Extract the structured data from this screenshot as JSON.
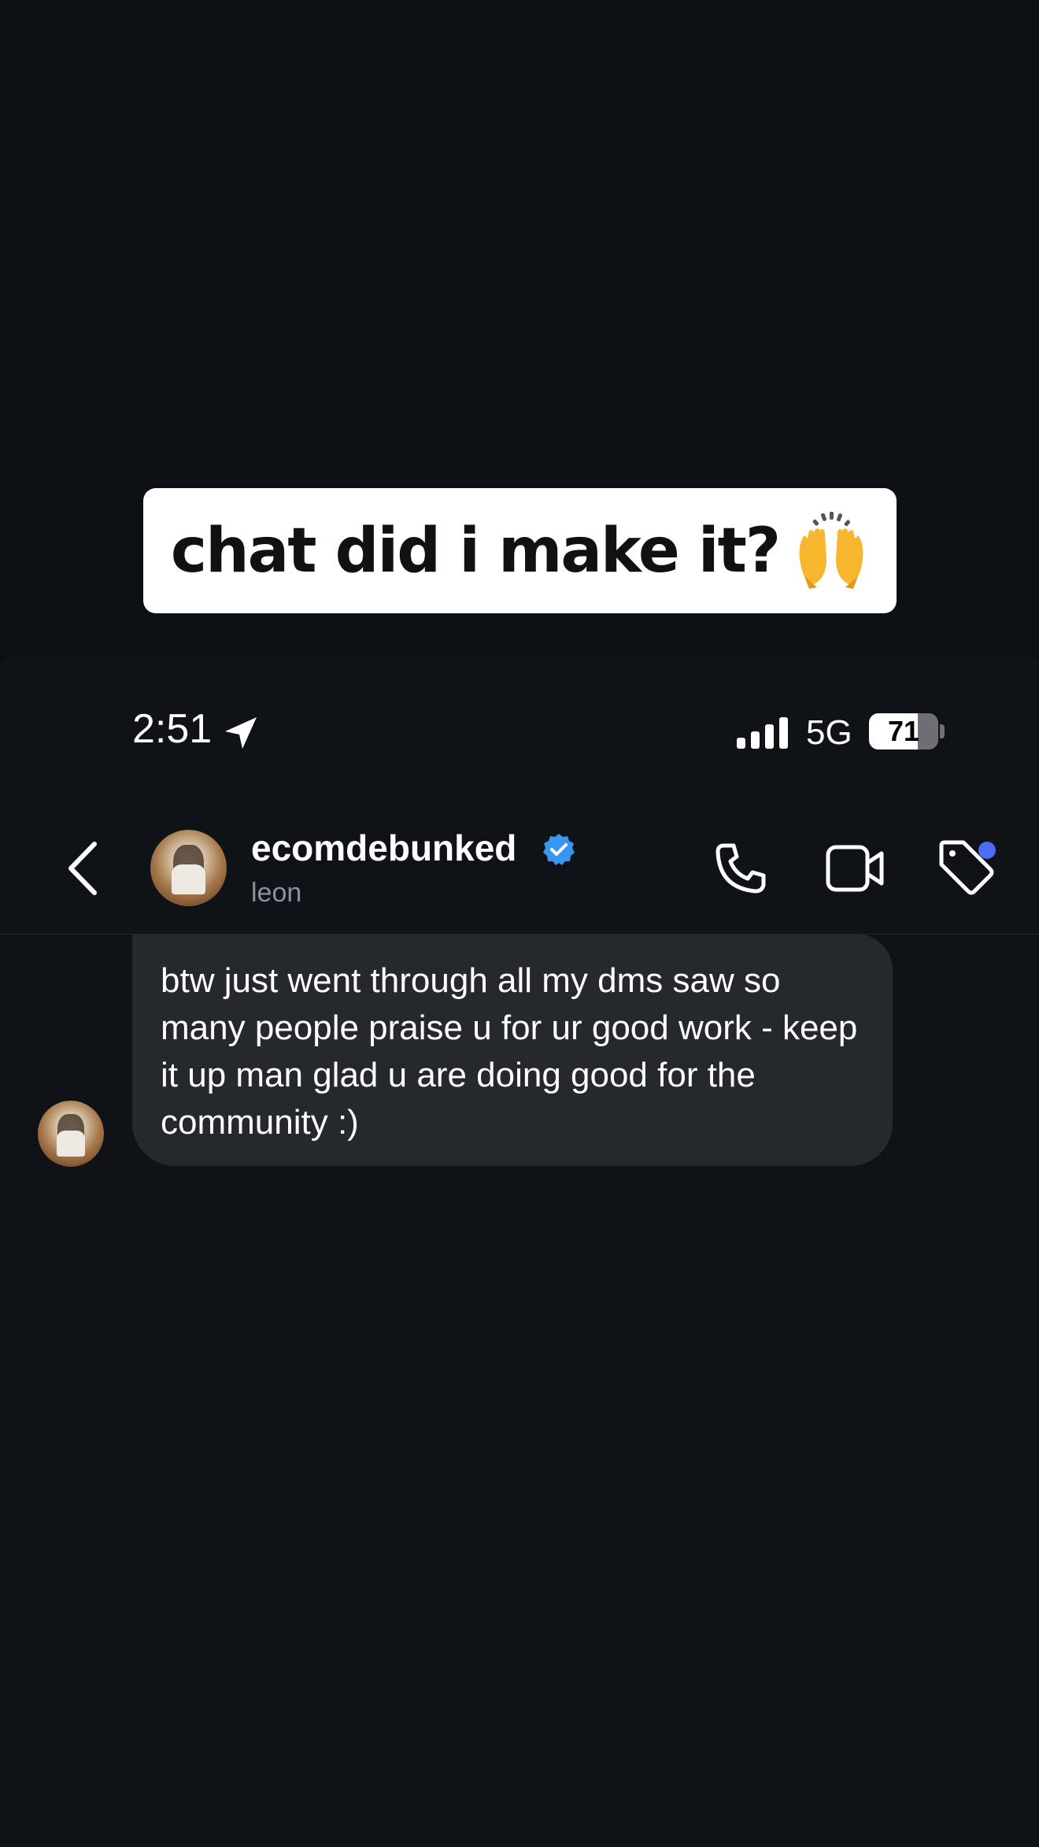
{
  "caption": {
    "text": "chat did i make it?",
    "emoji": "raising-hands-emoji"
  },
  "status_bar": {
    "time": "2:51",
    "network": "5G",
    "battery": "71",
    "battery_level": 0.71
  },
  "header": {
    "username": "ecomdebunked",
    "subtitle": "leon",
    "verified": true,
    "icons": [
      "back-chevron-icon",
      "phone-icon",
      "video-camera-icon",
      "tag-icon"
    ],
    "notification_dot_color": "#4a6cf7",
    "verified_color": "#3797f0"
  },
  "messages": [
    {
      "text": "btw just went through all my dms saw so many people praise u for ur good work - keep it up man glad u are doing good for the community :)"
    }
  ],
  "colors": {
    "background": "#0f1216",
    "bubble": "#25282d",
    "subtle_text": "#8e9399"
  }
}
